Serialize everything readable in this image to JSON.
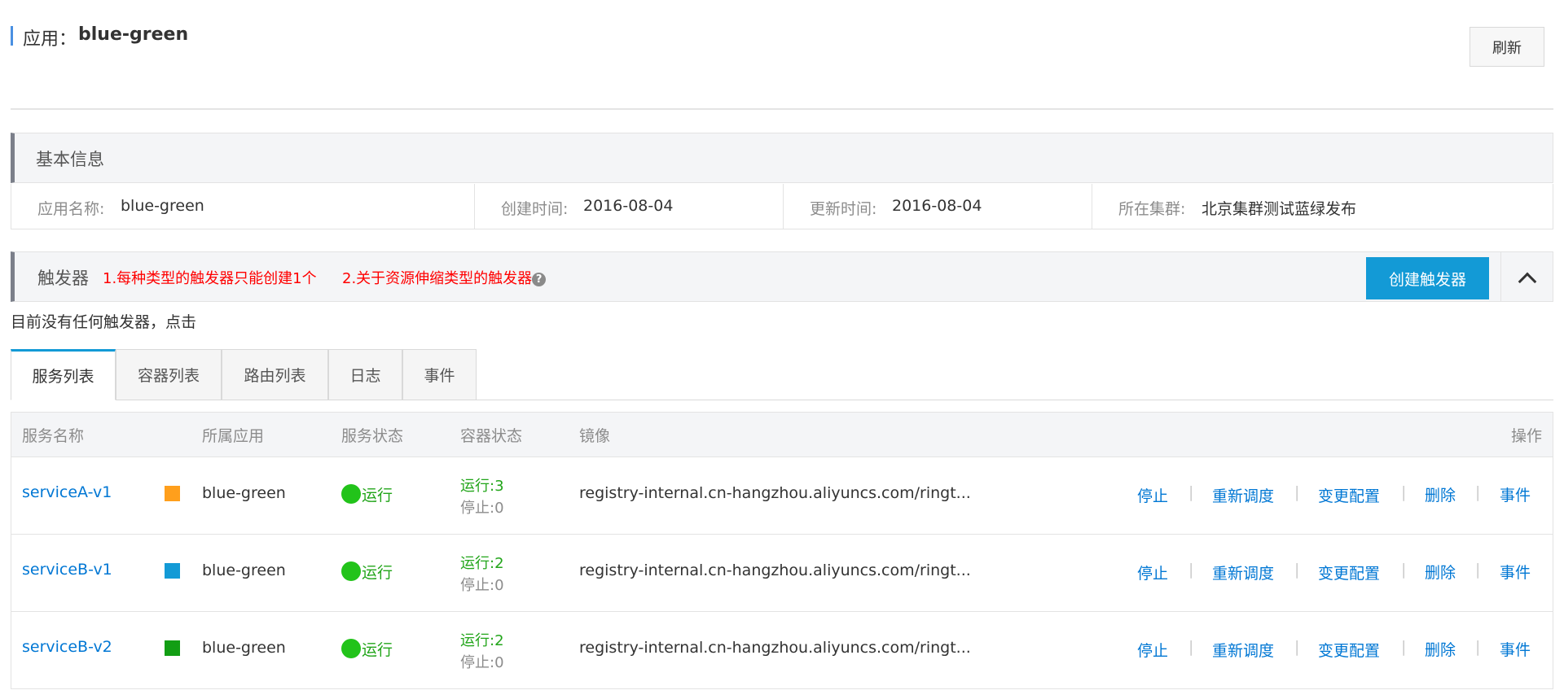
{
  "header": {
    "title_prefix": "应用：",
    "app_name": "blue-green",
    "refresh_label": "刷新"
  },
  "basic_info": {
    "title": "基本信息",
    "app_name_label": "应用名称:",
    "app_name_value": "blue-green",
    "created_label": "创建时间:",
    "created_value": "2016-08-04",
    "updated_label": "更新时间:",
    "updated_value": "2016-08-04",
    "cluster_label": "所在集群:",
    "cluster_value": "北京集群测试蓝绿发布"
  },
  "trigger": {
    "title": "触发器",
    "note1": "1.每种类型的触发器只能创建1个",
    "note2": "2.关于资源伸缩类型的触发器",
    "help_glyph": "?",
    "create_label": "创建触发器",
    "empty_message": "目前没有任何触发器，点击"
  },
  "tabs": [
    {
      "label": "服务列表",
      "active": true
    },
    {
      "label": "容器列表",
      "active": false
    },
    {
      "label": "路由列表",
      "active": false
    },
    {
      "label": "日志",
      "active": false
    },
    {
      "label": "事件",
      "active": false
    }
  ],
  "table": {
    "headers": {
      "service_name": "服务名称",
      "app": "所属应用",
      "service_status": "服务状态",
      "container_status": "容器状态",
      "image": "镜像",
      "ops": "操作"
    },
    "rows": [
      {
        "name": "serviceA-v1",
        "color": "#ff9f1c",
        "app": "blue-green",
        "status": "运行",
        "running": "运行:3",
        "stopped": "停止:0",
        "image": "registry-internal.cn-hangzhou.aliyuncs.com/ringt..."
      },
      {
        "name": "serviceB-v1",
        "color": "#139ad6",
        "app": "blue-green",
        "status": "运行",
        "running": "运行:2",
        "stopped": "停止:0",
        "image": "registry-internal.cn-hangzhou.aliyuncs.com/ringt..."
      },
      {
        "name": "serviceB-v2",
        "color": "#129e14",
        "app": "blue-green",
        "status": "运行",
        "running": "运行:2",
        "stopped": "停止:0",
        "image": "registry-internal.cn-hangzhou.aliyuncs.com/ringt..."
      }
    ],
    "actions": {
      "stop": "停止",
      "reschedule": "重新调度",
      "change_config": "变更配置",
      "delete": "删除",
      "events": "事件",
      "separator": "|"
    }
  },
  "colors": {
    "accent": "#139ad6",
    "link": "#0077d4",
    "running": "#22c31a",
    "warning_text": "#ff0000"
  },
  "icons": {
    "help": "question-circle-icon",
    "collapse": "chevron-up-icon",
    "status": "status-dot-icon"
  }
}
